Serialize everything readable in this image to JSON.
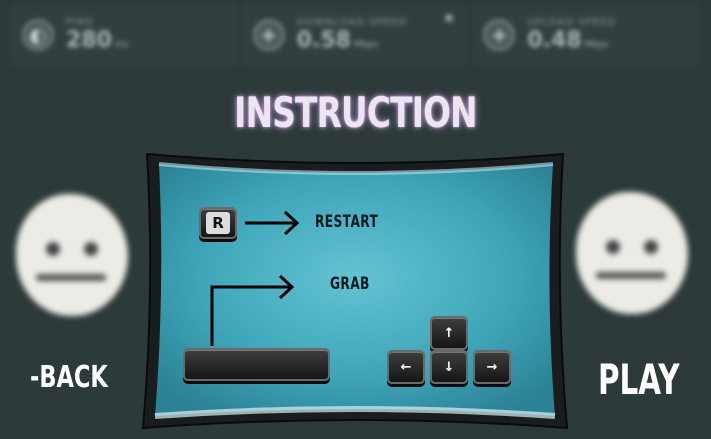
{
  "background_bar": {
    "ping": {
      "label": "PING",
      "value": "280",
      "unit": "ms",
      "icon": "ping-gauge-icon"
    },
    "download": {
      "label": "DOWNLOAD SPEED",
      "value": "0.58",
      "unit": "Mbps",
      "icon": "download-arrow-icon"
    },
    "upload": {
      "label": "UPLOAD SPEED",
      "value": "0.48",
      "unit": "Mbps",
      "icon": "upload-arrow-icon"
    }
  },
  "title": "INSTRUCTION",
  "controls": {
    "restart_key": "R",
    "restart_label": "RESTART",
    "grab_label": "GRAB",
    "arrow_up": "↑",
    "arrow_left": "←",
    "arrow_down": "↓",
    "arrow_right": "→"
  },
  "nav": {
    "back_label": "-BACK",
    "play_label": "PLAY"
  },
  "colors": {
    "tray": "#41a8bb",
    "title_glow": "#c896dc",
    "background": "#2c3b39"
  }
}
